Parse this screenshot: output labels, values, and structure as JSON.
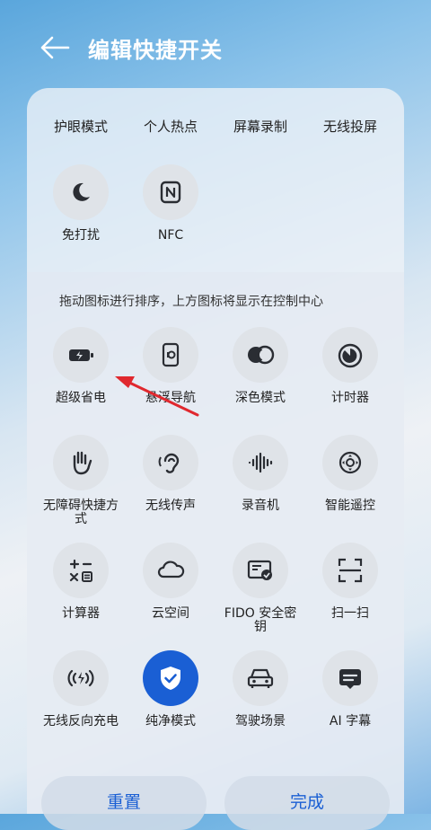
{
  "header": {
    "title": "编辑快捷开关"
  },
  "top_row": [
    "护眼模式",
    "个人热点",
    "屏幕录制",
    "无线投屏"
  ],
  "top_tiles": [
    {
      "label": "免打扰",
      "icon": "moon-icon"
    },
    {
      "label": "NFC",
      "icon": "nfc-icon"
    }
  ],
  "hint": "拖动图标进行排序，上方图标将显示在控制中心",
  "grid": [
    {
      "label": "超级省电",
      "icon": "battery-saver-icon"
    },
    {
      "label": "悬浮导航",
      "icon": "floating-nav-icon"
    },
    {
      "label": "深色模式",
      "icon": "dark-mode-icon"
    },
    {
      "label": "计时器",
      "icon": "timer-icon"
    },
    {
      "label": "无障碍快捷方式",
      "icon": "accessibility-hand-icon"
    },
    {
      "label": "无线传声",
      "icon": "ear-icon"
    },
    {
      "label": "录音机",
      "icon": "waveform-icon"
    },
    {
      "label": "智能遥控",
      "icon": "remote-icon"
    },
    {
      "label": "计算器",
      "icon": "calculator-icon"
    },
    {
      "label": "云空间",
      "icon": "cloud-icon"
    },
    {
      "label": "FIDO 安全密钥",
      "icon": "fido-key-icon"
    },
    {
      "label": "扫一扫",
      "icon": "scan-icon"
    },
    {
      "label": "无线反向充电",
      "icon": "reverse-charge-icon"
    },
    {
      "label": "纯净模式",
      "icon": "shield-check-icon",
      "active": true
    },
    {
      "label": "驾驶场景",
      "icon": "car-icon"
    },
    {
      "label": "AI 字幕",
      "icon": "subtitle-icon"
    }
  ],
  "buttons": {
    "reset": "重置",
    "done": "完成"
  },
  "colors": {
    "accent": "#1a5fd4",
    "annotation_arrow": "#e0282e"
  }
}
